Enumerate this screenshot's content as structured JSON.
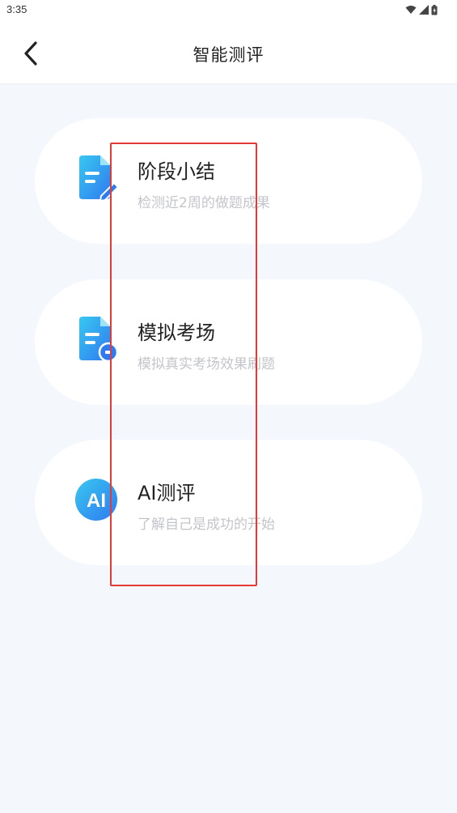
{
  "status_bar": {
    "time": "3:35",
    "icons": [
      "wifi-icon",
      "signal-icon",
      "battery-icon"
    ]
  },
  "header": {
    "title": "智能测评",
    "back_icon": "chevron-left-icon"
  },
  "cards": [
    {
      "title": "阶段小结",
      "desc": "检测近2周的做题成果",
      "icon": "document-edit-icon"
    },
    {
      "title": "模拟考场",
      "desc": "模拟真实考场效果刷题",
      "icon": "document-clock-icon"
    },
    {
      "title": "AI测评",
      "desc": "了解自己是成功的开始",
      "icon": "ai-badge-icon",
      "icon_text": "AI"
    }
  ],
  "colors": {
    "background": "#f4f7fc",
    "card": "#ffffff",
    "icon_gradient_start": "#38c8f0",
    "icon_gradient_end": "#2f7af0",
    "highlight": "#e53935"
  }
}
